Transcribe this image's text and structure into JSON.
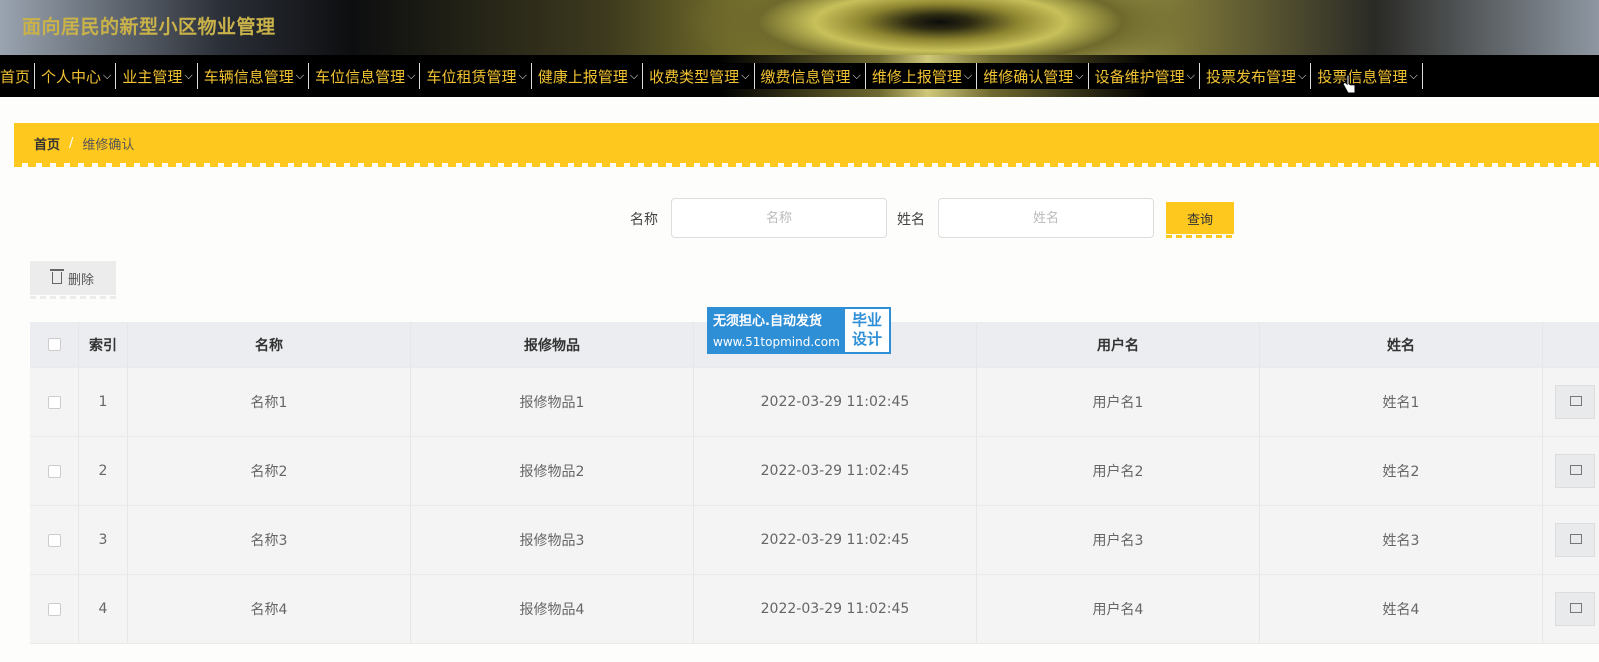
{
  "app": {
    "title": "面向居民的新型小区物业管理"
  },
  "nav": {
    "items": [
      {
        "label": "首页",
        "has_dropdown": false
      },
      {
        "label": "个人中心",
        "has_dropdown": true
      },
      {
        "label": "业主管理",
        "has_dropdown": true
      },
      {
        "label": "车辆信息管理",
        "has_dropdown": true
      },
      {
        "label": "车位信息管理",
        "has_dropdown": true
      },
      {
        "label": "车位租赁管理",
        "has_dropdown": true
      },
      {
        "label": "健康上报管理",
        "has_dropdown": true
      },
      {
        "label": "收费类型管理",
        "has_dropdown": true
      },
      {
        "label": "缴费信息管理",
        "has_dropdown": true
      },
      {
        "label": "维修上报管理",
        "has_dropdown": true
      },
      {
        "label": "维修确认管理",
        "has_dropdown": true
      },
      {
        "label": "设备维护管理",
        "has_dropdown": true
      },
      {
        "label": "投票发布管理",
        "has_dropdown": true
      },
      {
        "label": "投票信息管理",
        "has_dropdown": true
      }
    ]
  },
  "breadcrumb": {
    "home": "首页",
    "separator": "/",
    "current": "维修确认"
  },
  "search": {
    "name_label": "名称",
    "name_placeholder": "名称",
    "name_value": "",
    "person_label": "姓名",
    "person_placeholder": "姓名",
    "person_value": "",
    "query_label": "查询"
  },
  "toolbar": {
    "delete_label": "删除"
  },
  "table": {
    "headers": [
      "",
      "索引",
      "名称",
      "报修物品",
      "",
      "用户名",
      "姓名",
      ""
    ],
    "rows": [
      {
        "index": "1",
        "name": "名称1",
        "item": "报修物品1",
        "time": "2022-03-29 11:02:45",
        "username": "用户名1",
        "person": "姓名1"
      },
      {
        "index": "2",
        "name": "名称2",
        "item": "报修物品2",
        "time": "2022-03-29 11:02:45",
        "username": "用户名2",
        "person": "姓名2"
      },
      {
        "index": "3",
        "name": "名称3",
        "item": "报修物品3",
        "time": "2022-03-29 11:02:45",
        "username": "用户名3",
        "person": "姓名3"
      },
      {
        "index": "4",
        "name": "名称4",
        "item": "报修物品4",
        "time": "2022-03-29 11:02:45",
        "username": "用户名4",
        "person": "姓名4"
      }
    ]
  },
  "watermark": {
    "line1": "无须担心.自动发货",
    "line2": "www.51topmind.com",
    "right1": "毕业",
    "right2": "设计"
  },
  "colors": {
    "accent": "#ffc81e",
    "nav_text": "#f1c232",
    "watermark_blue": "#2f8fd6"
  }
}
